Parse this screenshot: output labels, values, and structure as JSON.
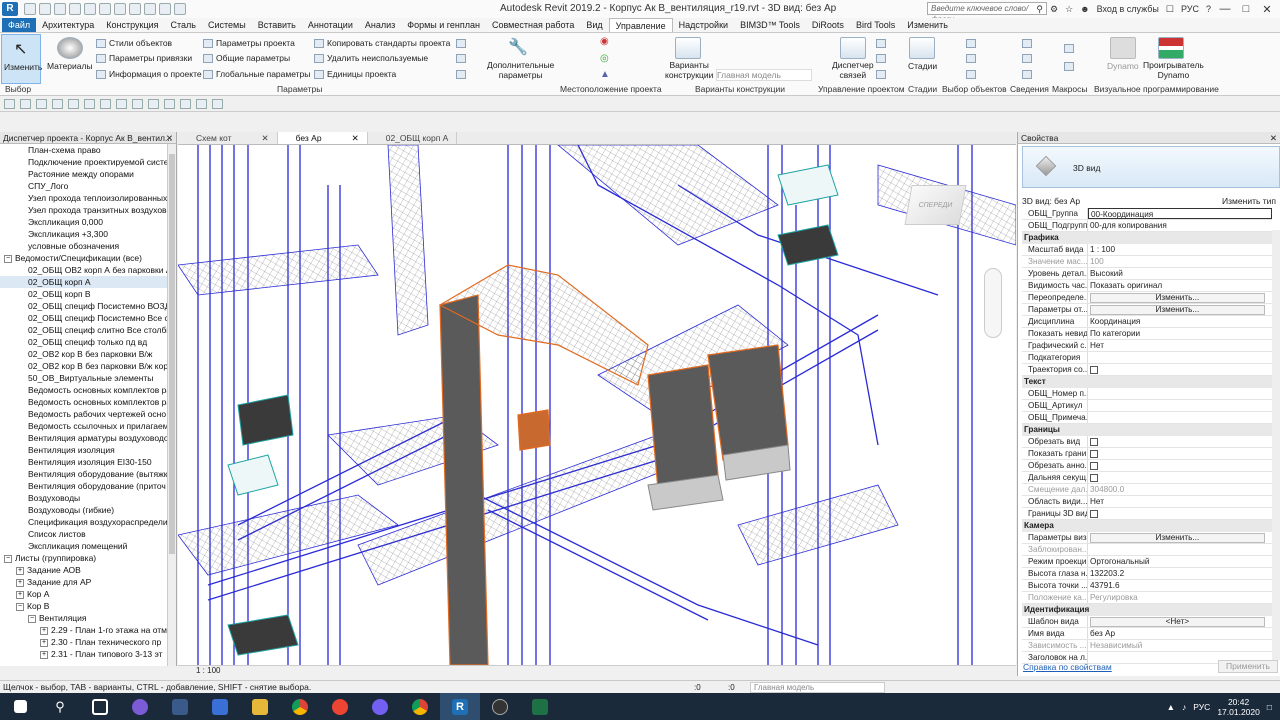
{
  "window": {
    "title": "Autodesk Revit 2019.2 - Корпус Ак В_вентиляция_r19.rvt - 3D вид: без Ар",
    "search_placeholder": "Введите ключевое слово/фразу",
    "login": "Вход в службы",
    "lang_btn": "РУС"
  },
  "tabs": [
    "Архитектура",
    "Конструкция",
    "Сталь",
    "Системы",
    "Вставить",
    "Аннотации",
    "Анализ",
    "Формы и генплан",
    "Совместная работа",
    "Вид",
    "Управление",
    "Надстройки",
    "BIM3D™ Tools",
    "DiRoots",
    "Bird Tools",
    "Изменить"
  ],
  "file_tab": "Файл",
  "ribbon": {
    "modify": "Изменить",
    "materials": "Материалы",
    "object_styles": "Стили объектов",
    "snap_params": "Параметры привязки",
    "project_info": "Информация о проекте",
    "project_params": "Параметры проекта",
    "shared_params": "Общие параметры",
    "global_params": "Глобальные параметры",
    "copy_standards": "Копировать стандарты проекта",
    "purge_unused": "Удалить неиспользуемые",
    "units": "Единицы проекта",
    "add_params_1": "Дополнительные",
    "add_params_2": "параметры",
    "params_panel": "Параметры",
    "location_panel": "Местоположение проекта",
    "design_options_1": "Варианты",
    "design_options_2": "конструкции",
    "main_model": "Главная модель",
    "design_options_panel": "Варианты конструкции",
    "manage_links_1": "Диспетчер",
    "manage_links_2": "связей",
    "manage_project_panel": "Управление проектом",
    "phases": "Стадии",
    "phases_panel": "Стадии",
    "selection_panel": "Выбор объектов",
    "inquiry_panel": "Сведения",
    "macros_panel": "Макросы",
    "dynamo": "Dynamo",
    "dynamo_player_1": "Проигрыватель",
    "dynamo_player_2": "Dynamo",
    "visual_prog_panel": "Визуальное программирование",
    "select_label": "Выбор"
  },
  "browser": {
    "title": "Диспетчер проекта - Корпус Ак В_вентил...",
    "items": [
      {
        "text": "План-схема право",
        "indent": 2,
        "exp": ""
      },
      {
        "text": "Подключение проектируемой систе",
        "indent": 2,
        "exp": ""
      },
      {
        "text": "Растояние между опорами",
        "indent": 2,
        "exp": ""
      },
      {
        "text": "СПУ_Лого",
        "indent": 2,
        "exp": ""
      },
      {
        "text": "Узел прохода теплоизолированных",
        "indent": 2,
        "exp": ""
      },
      {
        "text": "Узел прохода транзитных воздухово",
        "indent": 2,
        "exp": ""
      },
      {
        "text": "Экспликация 0,000",
        "indent": 2,
        "exp": ""
      },
      {
        "text": "Экспликация +3,300",
        "indent": 2,
        "exp": ""
      },
      {
        "text": "условные обозначения",
        "indent": 2,
        "exp": ""
      },
      {
        "text": "Ведомости/Спецификации (все)",
        "indent": 0,
        "exp": "−"
      },
      {
        "text": "02_ОБЩ ОВ2 корп А без парковки  А/",
        "indent": 2,
        "exp": ""
      },
      {
        "text": "02_ОБЩ корп А",
        "indent": 2,
        "exp": "",
        "sel": true
      },
      {
        "text": "02_ОБЩ корп В",
        "indent": 2,
        "exp": ""
      },
      {
        "text": "02_ОБЩ специф Посистемно ВОЗДУ",
        "indent": 2,
        "exp": ""
      },
      {
        "text": "02_ОБЩ специф Посистемно Все ст",
        "indent": 2,
        "exp": ""
      },
      {
        "text": "02_ОБЩ специф слитно Все столби",
        "indent": 2,
        "exp": ""
      },
      {
        "text": "02_ОБЩ специф только пд вд",
        "indent": 2,
        "exp": ""
      },
      {
        "text": "02_ОВ2 кор В без парковки  В/ж",
        "indent": 2,
        "exp": ""
      },
      {
        "text": "02_ОВ2 кор В без парковки  В/ж кор",
        "indent": 2,
        "exp": ""
      },
      {
        "text": "50_ОВ_Виртуальные элементы",
        "indent": 2,
        "exp": ""
      },
      {
        "text": "Ведомость основных комплектов ра",
        "indent": 2,
        "exp": ""
      },
      {
        "text": "Ведомость основных комплектов ра",
        "indent": 2,
        "exp": ""
      },
      {
        "text": "Ведомость рабочих чертежей осно",
        "indent": 2,
        "exp": ""
      },
      {
        "text": "Ведомость ссылочных и прилагаем",
        "indent": 2,
        "exp": ""
      },
      {
        "text": "Вентиляция арматуры воздуховодо",
        "indent": 2,
        "exp": ""
      },
      {
        "text": "Вентиляция изоляция",
        "indent": 2,
        "exp": ""
      },
      {
        "text": "Вентиляция изоляция EI30-150",
        "indent": 2,
        "exp": ""
      },
      {
        "text": "Вентиляция оборудование (вытяжк",
        "indent": 2,
        "exp": ""
      },
      {
        "text": "Вентиляция оборудование (приточ",
        "indent": 2,
        "exp": ""
      },
      {
        "text": "Воздуховоды",
        "indent": 2,
        "exp": ""
      },
      {
        "text": "Воздуховоды (гибкие)",
        "indent": 2,
        "exp": ""
      },
      {
        "text": "Спецификация воздухораспределит",
        "indent": 2,
        "exp": ""
      },
      {
        "text": "Список листов",
        "indent": 2,
        "exp": ""
      },
      {
        "text": "Экспликация помещений",
        "indent": 2,
        "exp": ""
      },
      {
        "text": "Листы (группировка)",
        "indent": 0,
        "exp": "−"
      },
      {
        "text": "Задание АОВ",
        "indent": 1,
        "exp": "+"
      },
      {
        "text": "Задание для АР",
        "indent": 1,
        "exp": "+"
      },
      {
        "text": "Кор А",
        "indent": 1,
        "exp": "+"
      },
      {
        "text": "Кор В",
        "indent": 1,
        "exp": "−"
      },
      {
        "text": "Вентиляция",
        "indent": 2,
        "exp": "−"
      },
      {
        "text": "2.29 - План 1-го этажа на отм",
        "indent": 3,
        "exp": "+"
      },
      {
        "text": "2.30 - План технического пр",
        "indent": 3,
        "exp": "+"
      },
      {
        "text": "2.31 - План типового 3-13 эт",
        "indent": 3,
        "exp": "+"
      }
    ]
  },
  "view_tabs": [
    "Схем кот",
    "без Ар",
    "02_ОБЩ корп А"
  ],
  "view_scale": "1 : 100",
  "props": {
    "title": "Свойства",
    "type_name": "3D вид",
    "selector": "3D вид: без Ар",
    "edit_type": "Изменить тип",
    "rows": [
      {
        "k": "ОБЩ_Группа",
        "v": "00-Координация",
        "t": "hl"
      },
      {
        "k": "ОБЩ_Подгруппа",
        "v": "00-для копирования",
        "t": ""
      },
      {
        "k": "Графика",
        "v": "",
        "t": "sec"
      },
      {
        "k": "Масштаб вида",
        "v": "1 : 100",
        "t": ""
      },
      {
        "k": "Значение мас...",
        "v": "100",
        "t": "gray"
      },
      {
        "k": "Уровень детал...",
        "v": "Высокий",
        "t": ""
      },
      {
        "k": "Видимость час...",
        "v": "Показать оригинал",
        "t": ""
      },
      {
        "k": "Переопределе...",
        "v": "Изменить...",
        "t": "btn"
      },
      {
        "k": "Параметры от...",
        "v": "Изменить...",
        "t": "btn"
      },
      {
        "k": "Дисциплина",
        "v": "Координация",
        "t": ""
      },
      {
        "k": "Показать невид...",
        "v": "По категории",
        "t": ""
      },
      {
        "k": "Графический с...",
        "v": "Нет",
        "t": ""
      },
      {
        "k": "Подкатегория",
        "v": "",
        "t": ""
      },
      {
        "k": "Траектория со...",
        "v": "",
        "t": "chk"
      },
      {
        "k": "Текст",
        "v": "",
        "t": "sec"
      },
      {
        "k": "ОБЩ_Номер п...",
        "v": "",
        "t": ""
      },
      {
        "k": "ОБЩ_Артикул",
        "v": "",
        "t": ""
      },
      {
        "k": "ОБЩ_Примеча...",
        "v": "",
        "t": ""
      },
      {
        "k": "Границы",
        "v": "",
        "t": "sec"
      },
      {
        "k": "Обрезать вид",
        "v": "",
        "t": "chk"
      },
      {
        "k": "Показать грани...",
        "v": "",
        "t": "chk"
      },
      {
        "k": "Обрезать анно...",
        "v": "",
        "t": "chk"
      },
      {
        "k": "Дальняя секущ...",
        "v": "",
        "t": "chk"
      },
      {
        "k": "Смещение дал...",
        "v": "304800.0",
        "t": "gray"
      },
      {
        "k": "Область види...",
        "v": "Нет",
        "t": ""
      },
      {
        "k": "Границы 3D вида",
        "v": "",
        "t": "chk"
      },
      {
        "k": "Камера",
        "v": "",
        "t": "sec"
      },
      {
        "k": "Параметры виз...",
        "v": "Изменить...",
        "t": "btn"
      },
      {
        "k": "Заблокирован...",
        "v": "",
        "t": "gray"
      },
      {
        "k": "Режим проекци...",
        "v": "Ортогональный",
        "t": ""
      },
      {
        "k": "Высота глаза н...",
        "v": "132203.2",
        "t": ""
      },
      {
        "k": "Высота точки ...",
        "v": "43791.6",
        "t": ""
      },
      {
        "k": "Положение ка...",
        "v": "Регулировка",
        "t": "gray"
      },
      {
        "k": "Идентификация",
        "v": "",
        "t": "sec"
      },
      {
        "k": "Шаблон вида",
        "v": "<Нет>",
        "t": "btn"
      },
      {
        "k": "Имя вида",
        "v": "без Ар",
        "t": ""
      },
      {
        "k": "Зависимость ...",
        "v": "Независимый",
        "t": "gray"
      },
      {
        "k": "Заголовок на л...",
        "v": "",
        "t": ""
      }
    ],
    "help_link": "Справка по свойствам",
    "apply": "Применить"
  },
  "status": {
    "text": "Щелчок - выбор, TAB - варианты, CTRL - добавление, SHIFT - снятие выбора.",
    "model": "Главная модель",
    "zero1": ":0",
    "zero2": ":0"
  },
  "tray": {
    "lang": "РУС",
    "time": "20:42",
    "date": "17.01.2020"
  },
  "viewcube": {
    "label": "СПЕРЕДИ"
  }
}
